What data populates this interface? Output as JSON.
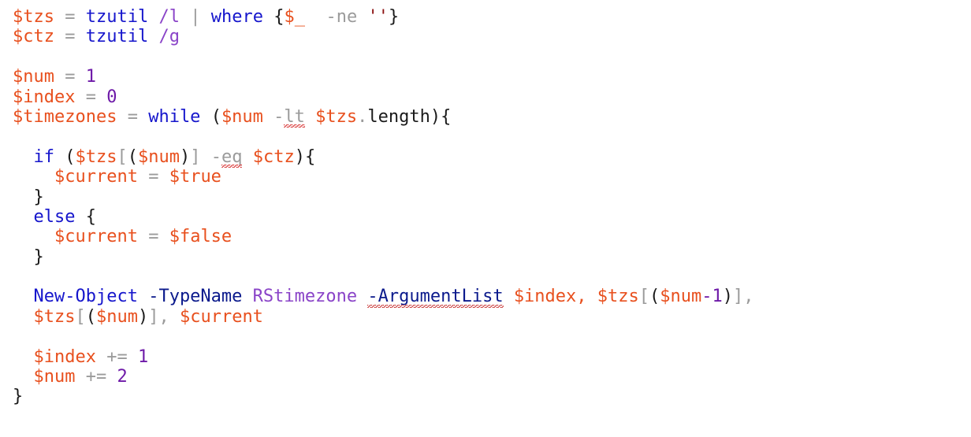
{
  "editor": {
    "language": "PowerShell",
    "background_color": "#FFFFFF",
    "font_size_px": 22,
    "line_height_px": 25.4,
    "theme_colors": {
      "variable": "#E8501E",
      "keyword": "#1616CC",
      "cmdlet": "#1616CC",
      "parameter": "#0B1A8C",
      "number": "#6E1AA8",
      "switch": "#8A44C8",
      "type": "#8A44C8",
      "operator": "#9B9B9B",
      "plain": "#1A1A1A",
      "string": "#8C1212",
      "error_underline": "#D42020"
    }
  },
  "lines": [
    {
      "id": 1,
      "text": "$tzs = tzutil /l | where {$_  -ne ''}",
      "tokens": [
        {
          "t": "$tzs",
          "c": "var"
        },
        {
          "t": " ",
          "c": "plain"
        },
        {
          "t": "=",
          "c": "op"
        },
        {
          "t": " ",
          "c": "plain"
        },
        {
          "t": "tzutil",
          "c": "cmd"
        },
        {
          "t": " ",
          "c": "plain"
        },
        {
          "t": "/l",
          "c": "param"
        },
        {
          "t": " ",
          "c": "plain"
        },
        {
          "t": "|",
          "c": "op"
        },
        {
          "t": " ",
          "c": "plain"
        },
        {
          "t": "where",
          "c": "kw"
        },
        {
          "t": " ",
          "c": "plain"
        },
        {
          "t": "{",
          "c": "plain"
        },
        {
          "t": "$_",
          "c": "var"
        },
        {
          "t": "  ",
          "c": "plain"
        },
        {
          "t": "-ne",
          "c": "op"
        },
        {
          "t": " ",
          "c": "plain"
        },
        {
          "t": "''",
          "c": "str"
        },
        {
          "t": "}",
          "c": "plain"
        }
      ]
    },
    {
      "id": 2,
      "text": "$ctz = tzutil /g",
      "tokens": [
        {
          "t": "$ctz",
          "c": "var"
        },
        {
          "t": " ",
          "c": "plain"
        },
        {
          "t": "=",
          "c": "op"
        },
        {
          "t": " ",
          "c": "plain"
        },
        {
          "t": "tzutil",
          "c": "cmd"
        },
        {
          "t": " ",
          "c": "plain"
        },
        {
          "t": "/g",
          "c": "param"
        }
      ]
    },
    {
      "id": 3,
      "text": "",
      "tokens": []
    },
    {
      "id": 4,
      "text": "$num = 1",
      "tokens": [
        {
          "t": "$num",
          "c": "var"
        },
        {
          "t": " ",
          "c": "plain"
        },
        {
          "t": "=",
          "c": "op"
        },
        {
          "t": " ",
          "c": "plain"
        },
        {
          "t": "1",
          "c": "num"
        }
      ]
    },
    {
      "id": 5,
      "text": "$index = 0",
      "tokens": [
        {
          "t": "$index",
          "c": "var"
        },
        {
          "t": " ",
          "c": "plain"
        },
        {
          "t": "=",
          "c": "op"
        },
        {
          "t": " ",
          "c": "plain"
        },
        {
          "t": "0",
          "c": "num"
        }
      ]
    },
    {
      "id": 6,
      "text": "$timezones = while ($num -lt $tzs.length){",
      "tokens": [
        {
          "t": "$timezones",
          "c": "var"
        },
        {
          "t": " ",
          "c": "plain"
        },
        {
          "t": "=",
          "c": "op"
        },
        {
          "t": " ",
          "c": "plain"
        },
        {
          "t": "while",
          "c": "kw"
        },
        {
          "t": " ",
          "c": "plain"
        },
        {
          "t": "(",
          "c": "plain"
        },
        {
          "t": "$num",
          "c": "var"
        },
        {
          "t": " ",
          "c": "plain"
        },
        {
          "t": "-",
          "c": "op"
        },
        {
          "t": "lt",
          "c": "op",
          "squiggle": true
        },
        {
          "t": " ",
          "c": "plain"
        },
        {
          "t": "$tzs",
          "c": "var"
        },
        {
          "t": ".",
          "c": "op"
        },
        {
          "t": "length",
          "c": "plain"
        },
        {
          "t": ")",
          "c": "plain"
        },
        {
          "t": "{",
          "c": "plain"
        }
      ]
    },
    {
      "id": 7,
      "text": "",
      "tokens": []
    },
    {
      "id": 8,
      "text": "  if ($tzs[($num)] -eq $ctz){",
      "tokens": [
        {
          "t": "  ",
          "c": "plain"
        },
        {
          "t": "if",
          "c": "kw"
        },
        {
          "t": " ",
          "c": "plain"
        },
        {
          "t": "(",
          "c": "plain"
        },
        {
          "t": "$tzs",
          "c": "var"
        },
        {
          "t": "[",
          "c": "op"
        },
        {
          "t": "(",
          "c": "plain"
        },
        {
          "t": "$num",
          "c": "var"
        },
        {
          "t": ")",
          "c": "plain"
        },
        {
          "t": "]",
          "c": "op"
        },
        {
          "t": " ",
          "c": "plain"
        },
        {
          "t": "-",
          "c": "op"
        },
        {
          "t": "eq",
          "c": "op",
          "squiggle": true
        },
        {
          "t": " ",
          "c": "plain"
        },
        {
          "t": "$ctz",
          "c": "var"
        },
        {
          "t": ")",
          "c": "plain"
        },
        {
          "t": "{",
          "c": "plain"
        }
      ]
    },
    {
      "id": 9,
      "text": "    $current = $true",
      "tokens": [
        {
          "t": "    ",
          "c": "plain"
        },
        {
          "t": "$current",
          "c": "var"
        },
        {
          "t": " ",
          "c": "plain"
        },
        {
          "t": "=",
          "c": "op"
        },
        {
          "t": " ",
          "c": "plain"
        },
        {
          "t": "$true",
          "c": "var"
        }
      ]
    },
    {
      "id": 10,
      "text": "  }",
      "tokens": [
        {
          "t": "  ",
          "c": "plain"
        },
        {
          "t": "}",
          "c": "plain"
        }
      ]
    },
    {
      "id": 11,
      "text": "  else {",
      "tokens": [
        {
          "t": "  ",
          "c": "plain"
        },
        {
          "t": "else",
          "c": "kw"
        },
        {
          "t": " ",
          "c": "plain"
        },
        {
          "t": "{",
          "c": "plain"
        }
      ]
    },
    {
      "id": 12,
      "text": "    $current = $false",
      "tokens": [
        {
          "t": "    ",
          "c": "plain"
        },
        {
          "t": "$current",
          "c": "var"
        },
        {
          "t": " ",
          "c": "plain"
        },
        {
          "t": "=",
          "c": "op"
        },
        {
          "t": " ",
          "c": "plain"
        },
        {
          "t": "$false",
          "c": "var"
        }
      ]
    },
    {
      "id": 13,
      "text": "  }",
      "tokens": [
        {
          "t": "  ",
          "c": "plain"
        },
        {
          "t": "}",
          "c": "plain"
        }
      ]
    },
    {
      "id": 14,
      "text": "",
      "tokens": []
    },
    {
      "id": 15,
      "text": "  New-Object -TypeName RStimezone -ArgumentList $index, $tzs[($num-1)],",
      "tokens": [
        {
          "t": "  ",
          "c": "plain"
        },
        {
          "t": "New-Object",
          "c": "cmd"
        },
        {
          "t": " ",
          "c": "plain"
        },
        {
          "t": "-TypeName",
          "c": "cmdlet2"
        },
        {
          "t": " ",
          "c": "plain"
        },
        {
          "t": "RStimezone",
          "c": "type"
        },
        {
          "t": " ",
          "c": "plain"
        },
        {
          "t": "-ArgumentList",
          "c": "cmdlet2",
          "squiggle": true
        },
        {
          "t": " ",
          "c": "plain"
        },
        {
          "t": "$index",
          "c": "var"
        },
        {
          "t": ",",
          "c": "var"
        },
        {
          "t": " ",
          "c": "plain"
        },
        {
          "t": "$tzs",
          "c": "var"
        },
        {
          "t": "[",
          "c": "op"
        },
        {
          "t": "(",
          "c": "plain"
        },
        {
          "t": "$num",
          "c": "var"
        },
        {
          "t": "-1",
          "c": "num"
        },
        {
          "t": ")",
          "c": "plain"
        },
        {
          "t": "]",
          "c": "op"
        },
        {
          "t": ",",
          "c": "op"
        }
      ]
    },
    {
      "id": 16,
      "text": "  $tzs[($num)], $current",
      "tokens": [
        {
          "t": "  ",
          "c": "plain"
        },
        {
          "t": "$tzs",
          "c": "var"
        },
        {
          "t": "[",
          "c": "op"
        },
        {
          "t": "(",
          "c": "plain"
        },
        {
          "t": "$num",
          "c": "var"
        },
        {
          "t": ")",
          "c": "plain"
        },
        {
          "t": "]",
          "c": "op"
        },
        {
          "t": ",",
          "c": "op"
        },
        {
          "t": " ",
          "c": "plain"
        },
        {
          "t": "$current",
          "c": "var"
        }
      ]
    },
    {
      "id": 17,
      "text": "",
      "tokens": []
    },
    {
      "id": 18,
      "text": "  $index += 1",
      "tokens": [
        {
          "t": "  ",
          "c": "plain"
        },
        {
          "t": "$index",
          "c": "var"
        },
        {
          "t": " ",
          "c": "plain"
        },
        {
          "t": "+=",
          "c": "op"
        },
        {
          "t": " ",
          "c": "plain"
        },
        {
          "t": "1",
          "c": "num"
        }
      ]
    },
    {
      "id": 19,
      "text": "  $num += 2",
      "tokens": [
        {
          "t": "  ",
          "c": "plain"
        },
        {
          "t": "$num",
          "c": "var"
        },
        {
          "t": " ",
          "c": "plain"
        },
        {
          "t": "+=",
          "c": "op"
        },
        {
          "t": " ",
          "c": "plain"
        },
        {
          "t": "2",
          "c": "num"
        }
      ]
    },
    {
      "id": 20,
      "text": "}",
      "tokens": [
        {
          "t": "}",
          "c": "plain"
        }
      ]
    }
  ]
}
